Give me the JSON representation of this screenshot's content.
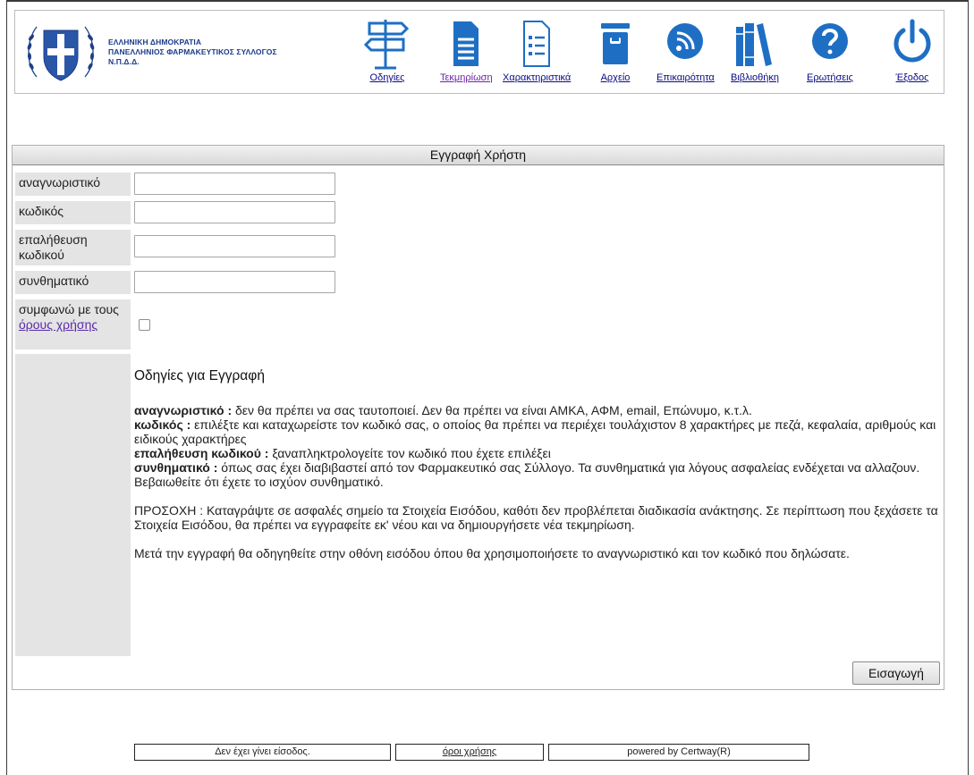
{
  "header": {
    "org_line1": "ΕΛΛΗΝΙΚΗ ΔΗΜΟΚΡΑΤΙΑ",
    "org_line2": "ΠΑΝΕΛΛΗΝΙΟΣ ΦΑΡΜΑΚΕΥΤΙΚΟΣ ΣΥΛΛΟΓΟΣ",
    "org_line3": "Ν.Π.Δ.Δ.",
    "nav": [
      {
        "label": "Οδηγίες",
        "icon": "signpost-icon"
      },
      {
        "label": "Τεκμηρίωση",
        "icon": "document-icon"
      },
      {
        "label": "Χαρακτηριστικά",
        "icon": "list-document-icon"
      },
      {
        "label": "Αρχείο",
        "icon": "archive-icon"
      },
      {
        "label": "Επικαιρότητα",
        "icon": "rss-icon"
      },
      {
        "label": "Βιβλιοθήκη",
        "icon": "library-icon"
      },
      {
        "label": "Ερωτήσεις",
        "icon": "question-icon"
      },
      {
        "label": "Έξοδος",
        "icon": "power-icon"
      }
    ],
    "colors": {
      "icon_blue": "#1e6fc4",
      "org_text": "#1b3a8a"
    }
  },
  "form": {
    "title": "Εγγραφή Χρήστη",
    "fields": [
      {
        "label": "αναγνωριστικό",
        "value": ""
      },
      {
        "label": "κωδικός",
        "value": ""
      },
      {
        "label": "επαλήθευση κωδικού",
        "value": ""
      },
      {
        "label": "συνθηματικό",
        "value": ""
      }
    ],
    "terms_prefix": "συμφωνώ με τους",
    "terms_link": "όρους χρήσης",
    "terms_checked": false,
    "instructions": {
      "heading": "Οδηγίες για Εγγραφή",
      "items": [
        {
          "term": "αναγνωριστικό :",
          "text": " δεν θα πρέπει να σας ταυτοποιεί. Δεν θα πρέπει να είναι ΑΜΚΑ, ΑΦΜ, email, Επώνυμο, κ.τ.λ."
        },
        {
          "term": "κωδικός :",
          "text": " επιλέξτε και καταχωρείστε τον κωδικό σας, ο οποίος θα πρέπει να περιέχει τουλάχιστον 8 χαρακτήρες με πεζά, κεφαλαία, αριθμούς και ειδικούς χαρακτήρες"
        },
        {
          "term": "επαλήθευση κωδικού :",
          "text": " ξαναπληκτρολογείτε τον κωδικό που έχετε επιλέξει"
        },
        {
          "term": "συνθηματικό :",
          "text": " όπως σας έχει διαβιβαστεί από τον Φαρμακευτικό σας Σύλλογο. Τα συνθηματικά για λόγους ασφαλείας ενδέχεται να αλλαζουν. Βεβαιωθείτε ότι έχετε το ισχύον συνθηματικό."
        }
      ],
      "warning": "ΠΡΟΣΟΧΗ : Καταγράψτε σε ασφαλές σημείο τα Στοιχεία Εισόδου, καθότι δεν προβλέπεται διαδικασία ανάκτησης. Σε περίπτωση που ξεχάσετε τα Στοιχεία Εισόδου, θα πρέπει να εγγραφείτε εκ' νέου και να δημιουργήσετε νέα τεκμηρίωση.",
      "after": "Μετά την εγγραφή θα οδηγηθείτε στην οθόνη εισόδου όπου θα χρησιμοποιήσετε το αναγνωριστικό και τον κωδικό που δηλώσατε."
    },
    "submit_label": "Εισαγωγή"
  },
  "footer": {
    "status": "Δεν έχει γίνει είσοδος.",
    "terms": "όροι χρήσης",
    "powered": "powered by Certway(R)"
  }
}
